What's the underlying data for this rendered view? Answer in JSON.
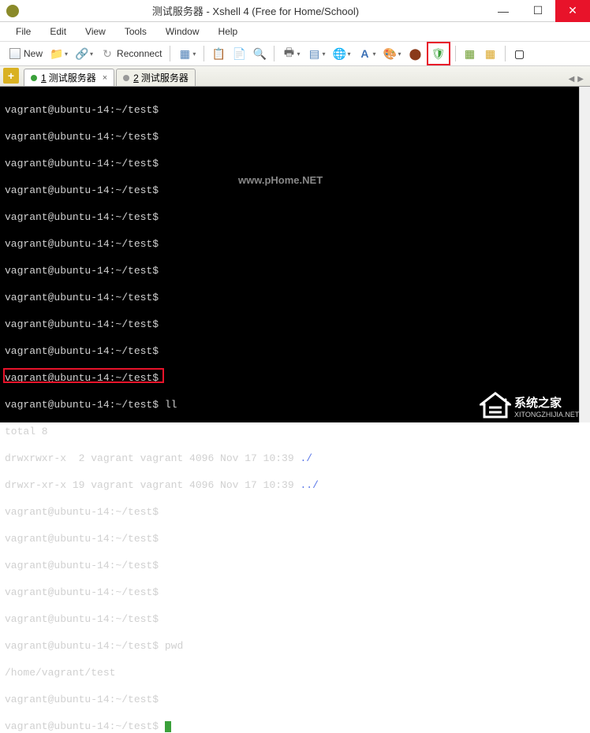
{
  "window": {
    "title": "测试服务器 - Xshell 4 (Free for Home/School)"
  },
  "menu": {
    "file": "File",
    "edit": "Edit",
    "view": "View",
    "tools": "Tools",
    "window": "Window",
    "help": "Help"
  },
  "toolbar": {
    "new": "New",
    "reconnect": "Reconnect",
    "font_letter": "A"
  },
  "tabs": {
    "t1_num": "1",
    "t1_label": "测试服务器",
    "t2_num": "2",
    "t2_label": "测试服务器"
  },
  "terminal": {
    "prompt": "vagrant@ubuntu-14:~/test$",
    "prompt_sp": "vagrant@ubuntu-14:~/test$ ",
    "cmd_ll": "ll",
    "total": "total 8",
    "ls1_a": "drwxrwxr-x  2 vagrant vagrant 4096 Nov 17 10:39 ",
    "ls1_b": "./",
    "ls2_a": "drwxr-xr-x 19 vagrant vagrant 4096 Nov 17 10:39 ",
    "ls2_b": "../",
    "cmd_pwd": "pwd",
    "pwd_out": "/home/vagrant/test",
    "watermark": "www.pHome.NET"
  },
  "logo": {
    "big": "系统之家",
    "small": "XITONGZHIJIA.NET"
  }
}
